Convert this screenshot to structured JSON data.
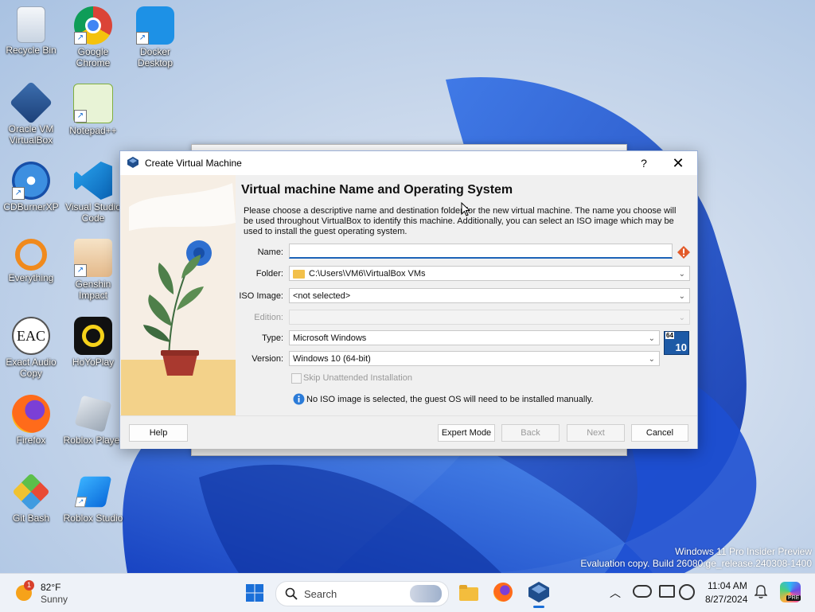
{
  "desktop": {
    "icons": [
      {
        "label": "Recycle Bin"
      },
      {
        "label": "Google Chrome"
      },
      {
        "label": "Docker Desktop"
      },
      {
        "label": "Oracle VM VirtualBox"
      },
      {
        "label": "Notepad++"
      },
      {
        "label": "CDBurnerXP"
      },
      {
        "label": "Visual Studio Code"
      },
      {
        "label": "Everything"
      },
      {
        "label": "Genshin Impact"
      },
      {
        "label": "Exact Audio Copy"
      },
      {
        "label": "HoYoPlay"
      },
      {
        "label": "Firefox"
      },
      {
        "label": "Roblox Player"
      },
      {
        "label": "Git Bash"
      },
      {
        "label": "Roblox Studio"
      }
    ],
    "eac_text": "EAC",
    "watermark": {
      "line1": "Windows 11 Pro Insider Preview",
      "line2": "Evaluation copy. Build 26080.ge_release.240308-1400"
    }
  },
  "dialog": {
    "title": "Create Virtual Machine",
    "help_glyph": "?",
    "close_glyph": "✕",
    "heading": "Virtual machine Name and Operating System",
    "description": "Please choose a descriptive name and destination folder for the new virtual machine. The name you choose will be used throughout VirtualBox to identify this machine. Additionally, you can select an ISO image which may be used to install the guest operating system.",
    "fields": {
      "name_label": "Name:",
      "name_value": "",
      "folder_label": "Folder:",
      "folder_value": "C:\\Users\\VM6\\VirtualBox VMs",
      "iso_label": "ISO Image:",
      "iso_value": "<not selected>",
      "edition_label": "Edition:",
      "edition_value": "",
      "type_label": "Type:",
      "type_value": "Microsoft Windows",
      "version_label": "Version:",
      "version_value": "Windows 10 (64-bit)"
    },
    "os_badge": {
      "bits": "64",
      "version": "10"
    },
    "skip_unattended_label": "Skip Unattended Installation",
    "skip_unattended_checked": false,
    "info_text": "No ISO image is selected, the guest OS will need to be installed manually.",
    "buttons": {
      "help": "Help",
      "expert": "Expert Mode",
      "back": "Back",
      "next": "Next",
      "cancel": "Cancel"
    }
  },
  "taskbar": {
    "weather_temp": "82°F",
    "weather_desc": "Sunny",
    "weather_badge": "1",
    "search_placeholder": "Search",
    "time": "11:04 AM",
    "date": "8/27/2024",
    "copilot_badge": "PRE"
  },
  "colors": {
    "accent": "#1c63b8",
    "taskbar_bg": "#eef2f8",
    "dialog_bg": "#f0f0f0",
    "bloom_blue": "#1450d8"
  }
}
